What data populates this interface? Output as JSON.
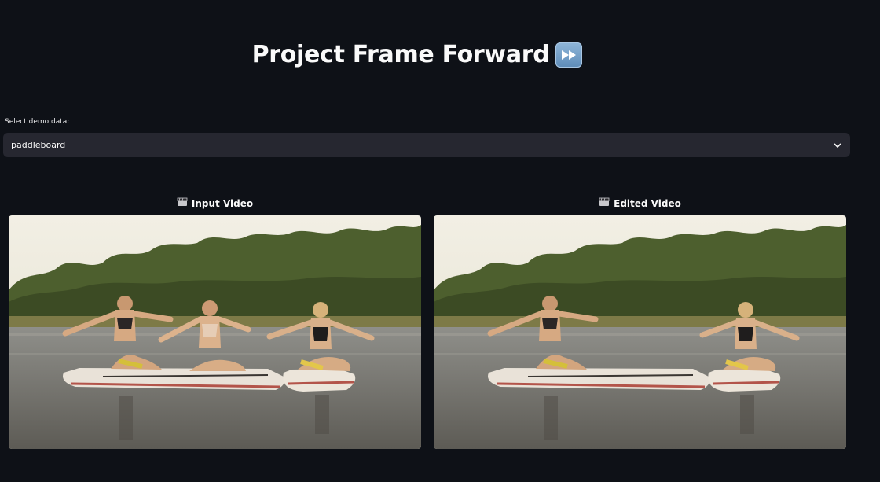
{
  "header": {
    "title": "Project Frame Forward",
    "title_icon": "fast-forward-icon"
  },
  "demo_select": {
    "label": "Select demo data:",
    "value": "paddleboard",
    "icon": "chevron-down-icon"
  },
  "columns": [
    {
      "heading": "Input Video",
      "icon": "clapperboard-icon"
    },
    {
      "heading": "Edited Video",
      "icon": "clapperboard-icon"
    }
  ],
  "colors": {
    "background": "#0e1117",
    "select_bg": "#262730",
    "text": "#fafafa"
  }
}
